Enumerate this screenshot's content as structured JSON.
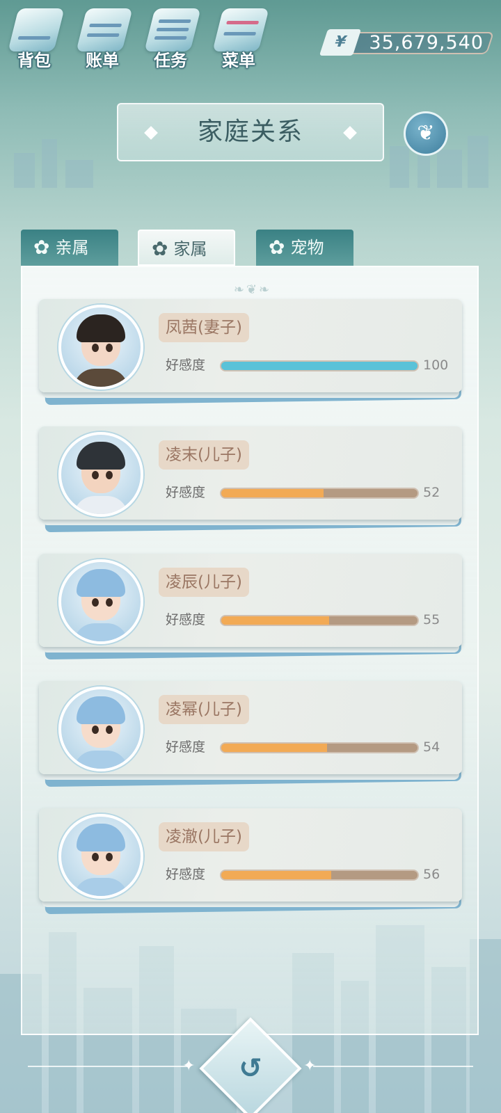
{
  "topbar": {
    "buttons": [
      {
        "label": "背包",
        "icon": "backpack-icon"
      },
      {
        "label": "账单",
        "icon": "bill-icon"
      },
      {
        "label": "任务",
        "icon": "task-icon"
      },
      {
        "label": "菜单",
        "icon": "menu-icon"
      }
    ],
    "currency_symbol": "¥",
    "money": "35,679,540"
  },
  "title": "家庭关系",
  "tree_icon": "family-tree-icon",
  "tabs": [
    {
      "label": "亲属",
      "icon": "flower-icon",
      "active": false
    },
    {
      "label": "家属",
      "icon": "flower-icon",
      "active": true
    },
    {
      "label": "宠物",
      "icon": "flower-icon",
      "active": false
    }
  ],
  "members": [
    {
      "name": "凤茜(妻子)",
      "affection_label": "好感度",
      "affection": 100,
      "affection_text": "100"
    },
    {
      "name": "凌末(儿子)",
      "affection_label": "好感度",
      "affection": 52,
      "affection_text": "52"
    },
    {
      "name": "凌辰(儿子)",
      "affection_label": "好感度",
      "affection": 55,
      "affection_text": "55"
    },
    {
      "name": "凌幂(儿子)",
      "affection_label": "好感度",
      "affection": 54,
      "affection_text": "54"
    },
    {
      "name": "凌澈(儿子)",
      "affection_label": "好感度",
      "affection": 56,
      "affection_text": "56"
    }
  ],
  "colors": {
    "affection_full": "#5ac2d8",
    "affection_partial": "#f2aa55",
    "affection_track": "#b49a82"
  },
  "back_icon": "back-arrow-icon"
}
